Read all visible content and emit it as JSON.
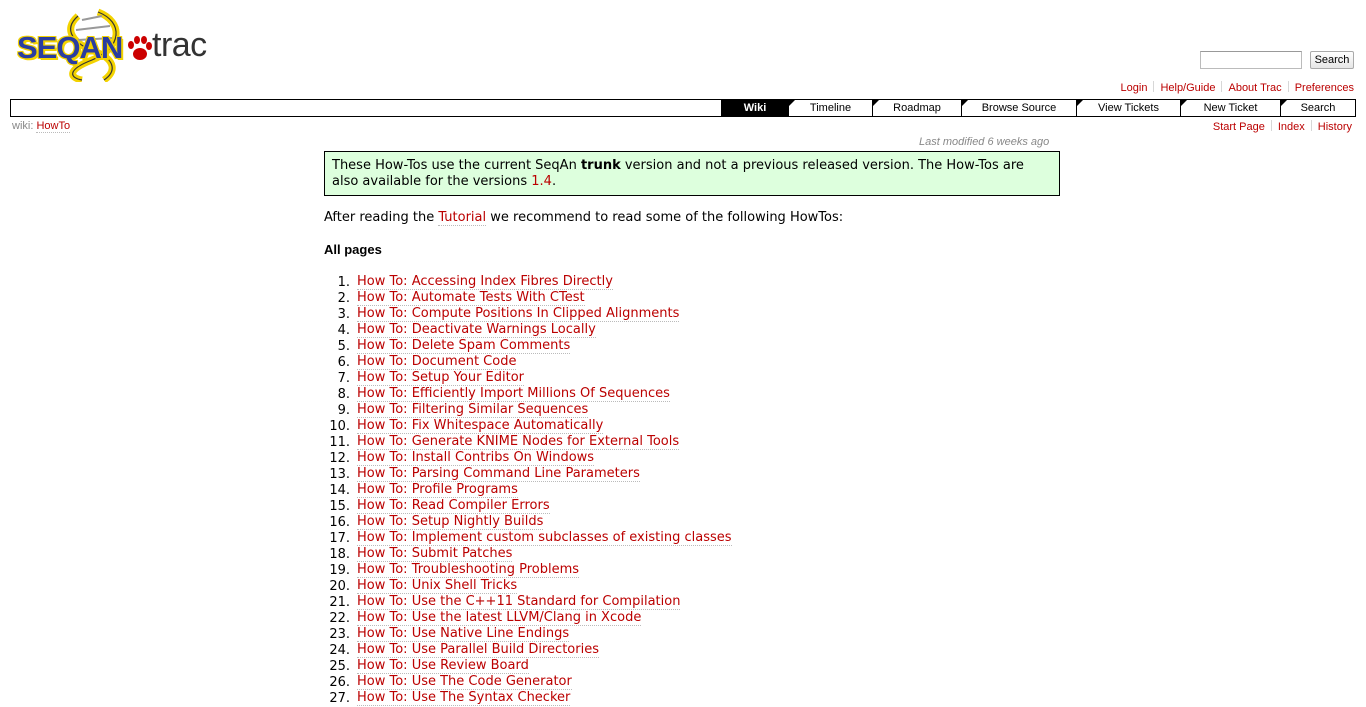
{
  "logo": {
    "word": "SEQAN",
    "trac": "trac"
  },
  "search": {
    "placeholder": "",
    "button_label": "Search"
  },
  "metanav": [
    "Login",
    "Help/Guide",
    "About Trac",
    "Preferences"
  ],
  "mainnav": [
    {
      "label": "Wiki",
      "active": true
    },
    {
      "label": "Timeline"
    },
    {
      "label": "Roadmap"
    },
    {
      "label": "Browse Source"
    },
    {
      "label": "View Tickets"
    },
    {
      "label": "New Ticket"
    },
    {
      "label": "Search"
    }
  ],
  "breadcrumb": {
    "prefix": "wiki:",
    "page": "HowTo"
  },
  "ctxtnav": [
    "Start Page",
    "Index",
    "History"
  ],
  "last_modified": "Last modified 6 weeks ago",
  "notice": {
    "part1": "These How-Tos use the current SeqAn ",
    "bold": "trunk",
    "part2": " version and not a previous released version. The How-Tos are also available for the versions ",
    "link": "1.4",
    "part3": "."
  },
  "intro": {
    "before": "After reading the ",
    "link": "Tutorial",
    "after": " we recommend to read some of the following HowTos:"
  },
  "heading": "All pages",
  "howtos": [
    "How To: Accessing Index Fibres Directly",
    "How To: Automate Tests With CTest",
    "How To: Compute Positions In Clipped Alignments",
    "How To: Deactivate Warnings Locally",
    "How To: Delete Spam Comments",
    "How To: Document Code",
    "How To: Setup Your Editor",
    "How To: Efficiently Import Millions Of Sequences",
    "How To: Filtering Similar Sequences",
    "How To: Fix Whitespace Automatically",
    "How To: Generate KNIME Nodes for External Tools",
    "How To: Install Contribs On Windows",
    "How To: Parsing Command Line Parameters",
    "How To: Profile Programs",
    "How To: Read Compiler Errors",
    "How To: Setup Nightly Builds",
    "How To: Implement custom subclasses of existing classes",
    "How To: Submit Patches",
    "How To: Troubleshooting Problems",
    "How To: Unix Shell Tricks",
    "How To: Use the C++11 Standard for Compilation",
    "How To: Use the latest LLVM/Clang in Xcode",
    "How To: Use Native Line Endings",
    "How To: Use Parallel Build Directories",
    "How To: Use Review Board",
    "How To: Use The Code Generator",
    "How To: Use The Syntax Checker"
  ]
}
